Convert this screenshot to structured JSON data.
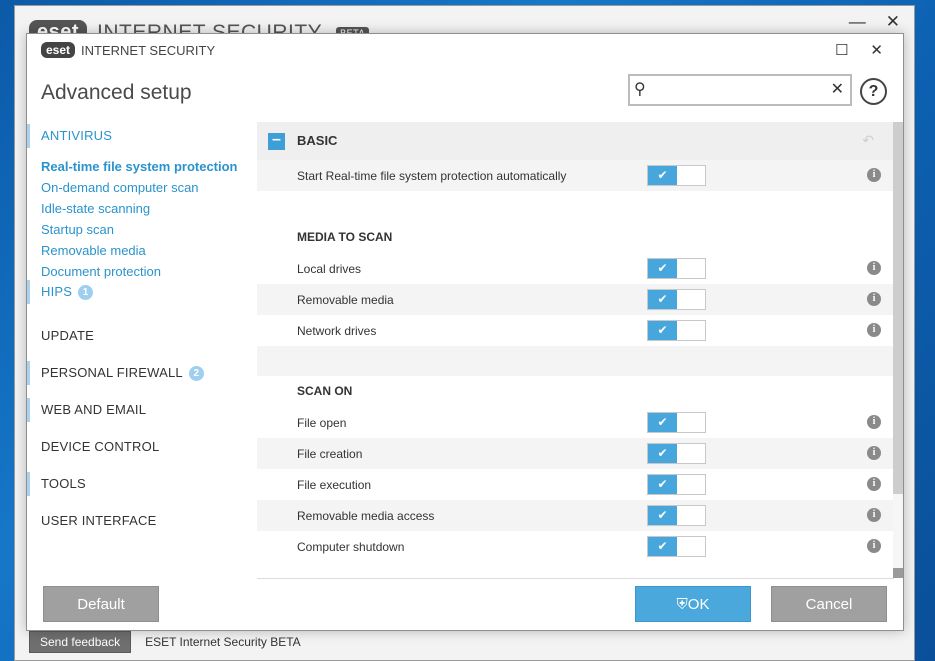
{
  "background_window": {
    "logo": "eset",
    "title": "INTERNET SECURITY",
    "beta": "BETA",
    "feedback_button": "Send feedback",
    "footer_text": "ESET Internet Security BETA"
  },
  "dialog": {
    "logo": "eset",
    "title": "INTERNET SECURITY",
    "heading": "Advanced setup",
    "search_value": "",
    "help_label": "?"
  },
  "sidebar": {
    "categories": [
      {
        "label": "ANTIVIRUS"
      },
      {
        "label": "UPDATE"
      },
      {
        "label": "PERSONAL FIREWALL",
        "badge": "2"
      },
      {
        "label": "WEB AND EMAIL"
      },
      {
        "label": "DEVICE CONTROL"
      },
      {
        "label": "TOOLS"
      },
      {
        "label": "USER INTERFACE"
      }
    ],
    "antivirus_items": [
      {
        "label": "Real-time file system protection"
      },
      {
        "label": "On-demand computer scan"
      },
      {
        "label": "Idle-state scanning"
      },
      {
        "label": "Startup scan"
      },
      {
        "label": "Removable media"
      },
      {
        "label": "Document protection"
      },
      {
        "label": "HIPS",
        "badge": "1"
      }
    ]
  },
  "content": {
    "section_title": "BASIC",
    "start_row": {
      "label": "Start Real-time file system protection automatically",
      "enabled": true
    },
    "media_heading": "MEDIA TO SCAN",
    "media_rows": [
      {
        "label": "Local drives",
        "enabled": true
      },
      {
        "label": "Removable media",
        "enabled": true
      },
      {
        "label": "Network drives",
        "enabled": true
      }
    ],
    "scan_heading": "SCAN ON",
    "scan_rows": [
      {
        "label": "File open",
        "enabled": true
      },
      {
        "label": "File creation",
        "enabled": true
      },
      {
        "label": "File execution",
        "enabled": true
      },
      {
        "label": "Removable media access",
        "enabled": true
      },
      {
        "label": "Computer shutdown",
        "enabled": true
      }
    ]
  },
  "buttons": {
    "default": "Default",
    "ok": "OK",
    "cancel": "Cancel"
  },
  "colors": {
    "accent": "#2a93cd",
    "toggle_on": "#47a6dc",
    "ok_button": "#4aa8dc"
  }
}
